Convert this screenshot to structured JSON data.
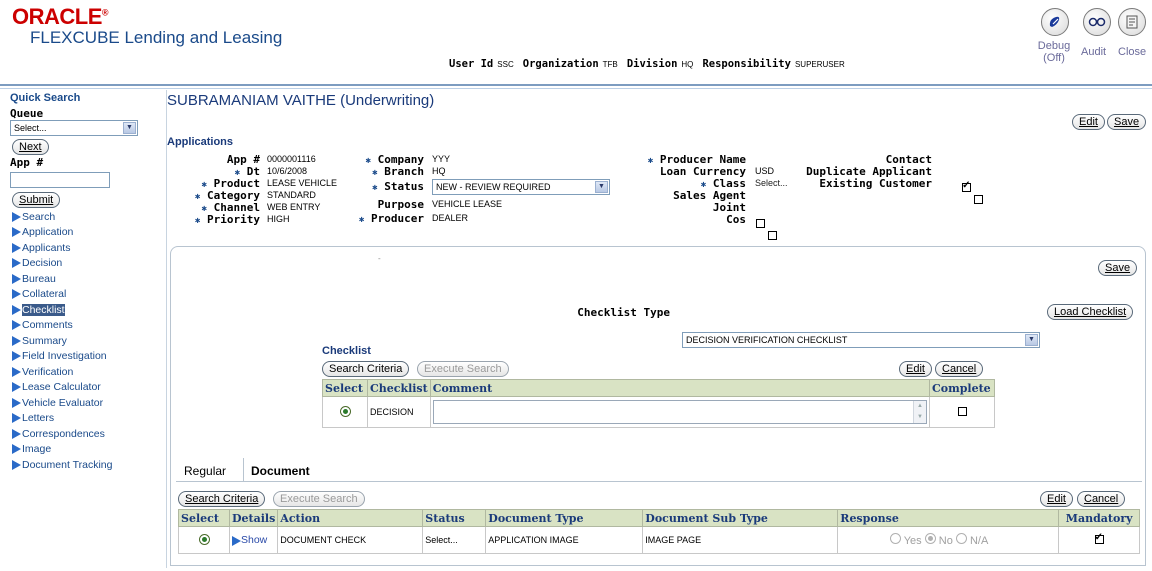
{
  "header": {
    "logo_brand": "ORACLE",
    "logo_product": "FLEXCUBE Lending and Leasing",
    "user_id_label": "User Id",
    "user_id": "SSC",
    "org_label": "Organization",
    "org": "TFB",
    "division_label": "Division",
    "division": "HQ",
    "responsibility_label": "Responsibility",
    "responsibility": "SUPERUSER",
    "debug_label": "Debug",
    "debug_state": "(Off)",
    "audit_label": "Audit",
    "close_label": "Close"
  },
  "sidebar": {
    "quick_search": "Quick Search",
    "queue_label": "Queue",
    "queue_value": "Select...",
    "next_button": "Next",
    "app_label": "App #",
    "app_value": "",
    "submit_button": "Submit",
    "items": [
      {
        "label": "Search"
      },
      {
        "label": "Application"
      },
      {
        "label": "Applicants"
      },
      {
        "label": "Decision"
      },
      {
        "label": "Bureau"
      },
      {
        "label": "Collateral"
      },
      {
        "label": "Checklist"
      },
      {
        "label": "Comments"
      },
      {
        "label": "Summary"
      },
      {
        "label": "Field Investigation"
      },
      {
        "label": "Verification"
      },
      {
        "label": "Lease Calculator"
      },
      {
        "label": "Vehicle Evaluator"
      },
      {
        "label": "Letters"
      },
      {
        "label": "Correspondences"
      },
      {
        "label": "Image"
      },
      {
        "label": "Document Tracking"
      }
    ],
    "selected_item": "Checklist"
  },
  "main": {
    "title": "SUBRAMANIAM VAITHE (Underwriting)",
    "edit_button": "Edit",
    "save_button": "Save",
    "applications_label": "Applications",
    "fields": {
      "app_no_label": "App #",
      "app_no": "0000001116",
      "dt_label": "Dt",
      "dt": "10/6/2008",
      "product_label": "Product",
      "product": "LEASE VEHICLE",
      "category_label": "Category",
      "category": "STANDARD",
      "channel_label": "Channel",
      "channel": "WEB ENTRY",
      "priority_label": "Priority",
      "priority": "HIGH",
      "company_label": "Company",
      "company": "YYY",
      "branch_label": "Branch",
      "branch": "HQ",
      "status_label": "Status",
      "status": "NEW - REVIEW REQUIRED",
      "purpose_label": "Purpose",
      "purpose": "VEHICLE LEASE",
      "producer_label": "Producer",
      "producer": "DEALER",
      "producer_name_label": "Producer Name",
      "loan_currency_label": "Loan Currency",
      "loan_currency": "USD",
      "class_label": "Class",
      "class": "Select...",
      "sales_agent_label": "Sales Agent",
      "joint_label": "Joint",
      "cos_label": "Cos",
      "contact_label": "Contact",
      "duplicate_label": "Duplicate Applicant",
      "existing_label": "Existing Customer"
    },
    "panel_save": "Save",
    "checklist_type_label": "Checklist Type",
    "checklist_type_value": "DECISION VERIFICATION CHECKLIST",
    "load_checklist": "Load Checklist",
    "checklist_label": "Checklist",
    "search_criteria": "Search Criteria",
    "execute_search": "Execute Search",
    "edit": "Edit",
    "cancel": "Cancel",
    "checklist_headers": [
      "Select",
      "Checklist",
      "Comment",
      "Complete"
    ],
    "checklist_row": {
      "checklist": "DECISION",
      "comment": ""
    },
    "tabs": [
      "Regular",
      "Document"
    ],
    "doc_headers": [
      "Select",
      "Details",
      "Action",
      "Status",
      "Document Type",
      "Document Sub Type",
      "Response",
      "Mandatory"
    ],
    "doc_row": {
      "details": "Show",
      "action": "DOCUMENT CHECK",
      "status": "Select...",
      "document_type": "APPLICATION IMAGE",
      "document_sub_type": "IMAGE PAGE",
      "response_options": [
        "Yes",
        "No",
        "N/A"
      ],
      "response_selected": "No"
    }
  }
}
